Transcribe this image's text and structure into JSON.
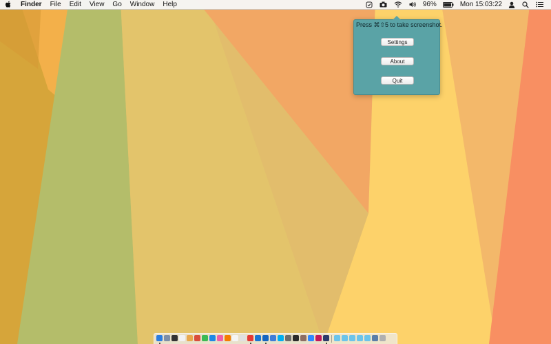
{
  "menubar": {
    "apple_icon": "apple-logo-icon",
    "app_name": "Finder",
    "menus": [
      "File",
      "Edit",
      "View",
      "Go",
      "Window",
      "Help"
    ],
    "status_icons": [
      "screenshot-app-icon",
      "camera-icon",
      "wifi-icon",
      "volume-icon"
    ],
    "battery_percent": "96%",
    "battery_level": 0.96,
    "clock": "Mon 15:03:22",
    "user_icon": "user-icon",
    "spotlight_icon": "search-icon",
    "notifications_icon": "notification-center-icon"
  },
  "popover": {
    "hint": "Press ⌘⇧5 to take screenshot.",
    "buttons": {
      "settings": "Settings",
      "about": "About",
      "quit": "Quit"
    },
    "background": "#5aa3a6"
  },
  "wallpaper_colors": [
    "#d6a53a",
    "#f3b04a",
    "#b4bd6a",
    "#e3c46b",
    "#f2a764",
    "#fdd26a",
    "#f3b86a",
    "#f88f62"
  ],
  "dock": {
    "apps": [
      {
        "name": "finder",
        "color": "#2b7de0",
        "running": true
      },
      {
        "name": "launchpad",
        "color": "#7d8fa8",
        "running": false
      },
      {
        "name": "photo-booth",
        "color": "#333333",
        "running": false
      },
      {
        "name": "calendar",
        "color": "#f2f2f2",
        "running": false
      },
      {
        "name": "photos",
        "color": "#e9a74c",
        "running": false
      },
      {
        "name": "chrome",
        "color": "#d94e3b",
        "running": false
      },
      {
        "name": "facetime",
        "color": "#3cba54",
        "running": false
      },
      {
        "name": "safari",
        "color": "#1e88e5",
        "running": false
      },
      {
        "name": "itunes",
        "color": "#ef5fa7",
        "running": false
      },
      {
        "name": "ibooks",
        "color": "#f57c00",
        "running": false
      },
      {
        "name": "notes",
        "color": "#f5f5f5",
        "running": false
      },
      {
        "name": "textedit",
        "color": "#e0e0e0",
        "running": false
      },
      {
        "name": "chrome-2",
        "color": "#e53935",
        "running": true
      },
      {
        "name": "app-store",
        "color": "#1976d2",
        "running": false
      },
      {
        "name": "xcode",
        "color": "#1565c0",
        "running": true
      },
      {
        "name": "preview",
        "color": "#3f7dd8",
        "running": false
      },
      {
        "name": "skype",
        "color": "#00aff0",
        "running": false
      },
      {
        "name": "system-preferences",
        "color": "#6d6d6d",
        "running": false
      },
      {
        "name": "terminal",
        "color": "#2b2b2b",
        "running": false
      },
      {
        "name": "script-editor",
        "color": "#8d6e63",
        "running": false
      },
      {
        "name": "dropbox",
        "color": "#2f88ff",
        "running": false
      },
      {
        "name": "instruments",
        "color": "#c2185b",
        "running": false
      },
      {
        "name": "photoshop",
        "color": "#2d3a6b",
        "running": true
      }
    ],
    "stacks": [
      {
        "name": "folder-1",
        "color": "#6cc4ea"
      },
      {
        "name": "folder-2",
        "color": "#6cc4ea"
      },
      {
        "name": "folder-3",
        "color": "#6cc4ea"
      },
      {
        "name": "folder-4",
        "color": "#6cc4ea"
      },
      {
        "name": "folder-5",
        "color": "#6cc4ea"
      },
      {
        "name": "downloads",
        "color": "#5a7ea8"
      },
      {
        "name": "trash",
        "color": "#b0b0b0"
      }
    ]
  }
}
